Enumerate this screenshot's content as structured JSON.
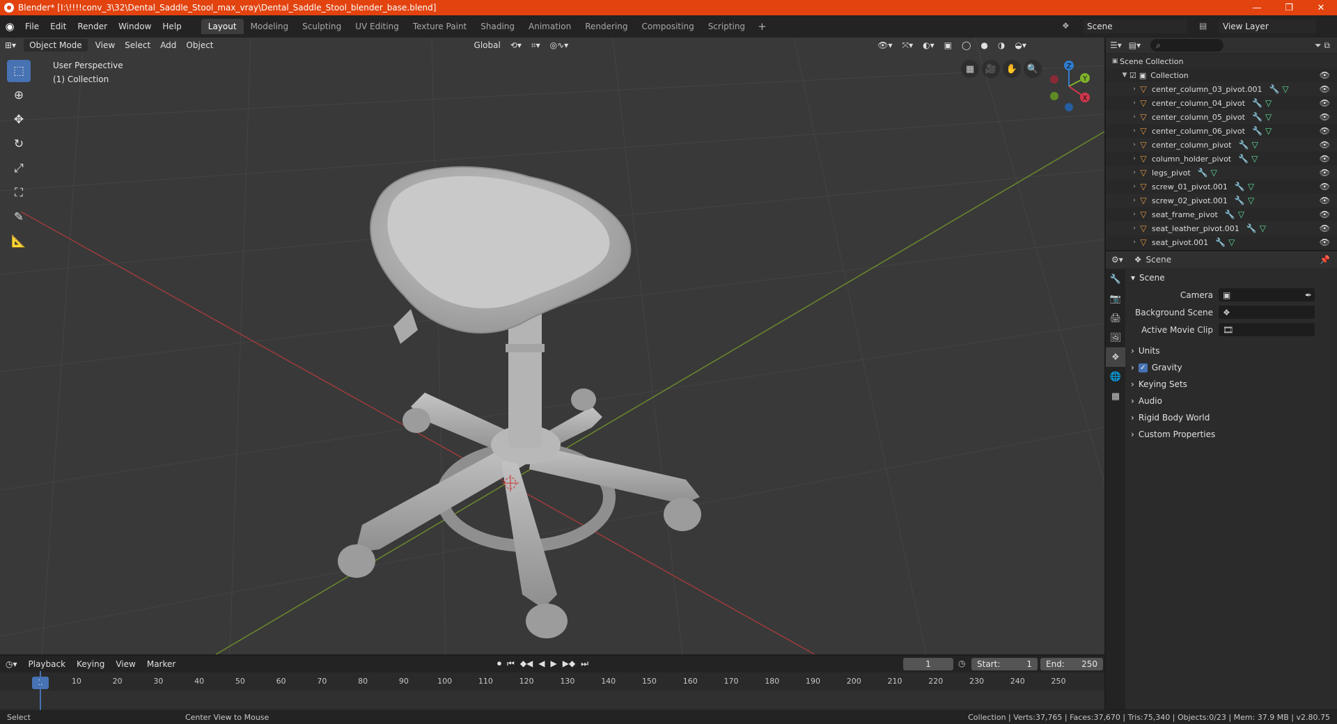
{
  "window": {
    "title": "Blender* [I:\\!!!!conv_3\\32\\Dental_Saddle_Stool_max_vray\\Dental_Saddle_Stool_blender_base.blend]",
    "minimize": "—",
    "maximize": "❐",
    "close": "✕"
  },
  "menu": [
    "File",
    "Edit",
    "Render",
    "Window",
    "Help"
  ],
  "workspaces": [
    "Layout",
    "Modeling",
    "Sculpting",
    "UV Editing",
    "Texture Paint",
    "Shading",
    "Animation",
    "Rendering",
    "Compositing",
    "Scripting"
  ],
  "active_workspace": "Layout",
  "scene_name": "Scene",
  "view_layer": "View Layer",
  "viewport": {
    "mode": "Object Mode",
    "menus": [
      "View",
      "Select",
      "Add",
      "Object"
    ],
    "transform_orientation": "Global",
    "info_line1": "User Perspective",
    "info_line2": "(1) Collection",
    "gizmo": {
      "z": "Z",
      "y": "Y",
      "x": "X"
    }
  },
  "timeline": {
    "menus": [
      "Playback",
      "Keying",
      "View",
      "Marker"
    ],
    "current_frame": "1",
    "start_label": "Start:",
    "start": "1",
    "end_label": "End:",
    "end": "250",
    "ticks": [
      "1",
      "10",
      "20",
      "30",
      "40",
      "50",
      "60",
      "70",
      "80",
      "90",
      "100",
      "110",
      "120",
      "130",
      "140",
      "150",
      "160",
      "170",
      "180",
      "190",
      "200",
      "210",
      "220",
      "230",
      "240",
      "250"
    ]
  },
  "statusbar": {
    "select": "Select",
    "center_view": "Center View to Mouse",
    "stats": "Collection | Verts:37,765 | Faces:37,670 | Tris:75,340 | Objects:0/23 | Mem: 37.9 MB | v2.80.75"
  },
  "outliner": {
    "root": "Scene Collection",
    "collection": "Collection",
    "objects": [
      "center_column_03_pivot.001",
      "center_column_04_pivot",
      "center_column_05_pivot",
      "center_column_06_pivot",
      "center_column_pivot",
      "column_holder_pivot",
      "legs_pivot",
      "screw_01_pivot.001",
      "screw_02_pivot.001",
      "seat_frame_pivot",
      "seat_leather_pivot.001",
      "seat_pivot.001"
    ]
  },
  "properties": {
    "header": "Scene",
    "section": "Scene",
    "fields": [
      {
        "label": "Camera",
        "value": ""
      },
      {
        "label": "Background Scene",
        "value": ""
      },
      {
        "label": "Active Movie Clip",
        "value": ""
      }
    ],
    "subpanels": [
      "Units",
      "Gravity",
      "Keying Sets",
      "Audio",
      "Rigid Body World",
      "Custom Properties"
    ]
  }
}
